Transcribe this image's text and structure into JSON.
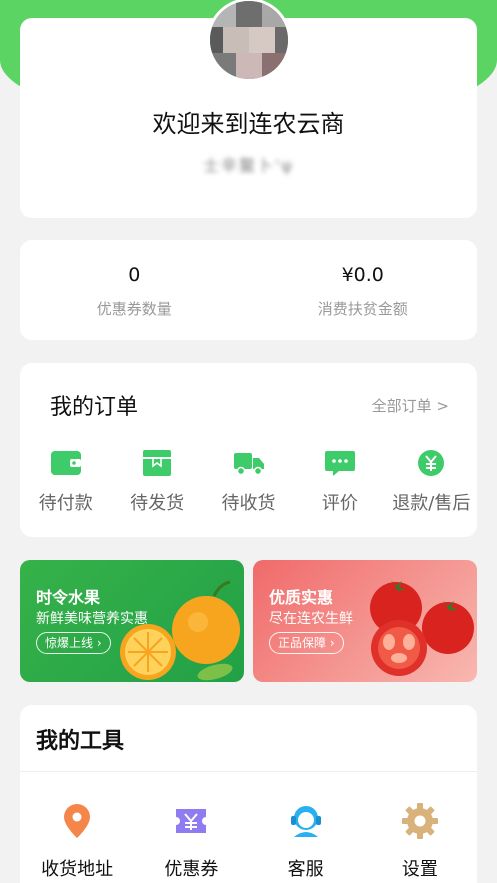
{
  "profile": {
    "welcome": "欢迎来到连农云商",
    "username": "士辛鳌卜'ψ"
  },
  "stats": [
    {
      "value": "0",
      "label": "优惠券数量"
    },
    {
      "value": "¥0.0",
      "label": "消费扶贫金额"
    }
  ],
  "orders": {
    "title": "我的订单",
    "all_link": "全部订单 >",
    "items": [
      {
        "label": "待付款",
        "icon": "wallet-icon"
      },
      {
        "label": "待发货",
        "icon": "package-icon"
      },
      {
        "label": "待收货",
        "icon": "truck-icon"
      },
      {
        "label": "评价",
        "icon": "chat-icon"
      },
      {
        "label": "退款/售后",
        "icon": "yuan-coin-icon"
      }
    ]
  },
  "promos": [
    {
      "title": "时令水果",
      "subtitle": "新鲜美味营养实惠",
      "button": "惊爆上线 ›"
    },
    {
      "title": "优质实惠",
      "subtitle": "尽在连农生鲜",
      "button": "正品保障 ›"
    }
  ],
  "tools": {
    "title": "我的工具",
    "items": [
      {
        "label": "收货地址",
        "icon": "location-pin-icon"
      },
      {
        "label": "优惠券",
        "icon": "coupon-icon"
      },
      {
        "label": "客服",
        "icon": "customer-service-icon"
      },
      {
        "label": "设置",
        "icon": "gear-icon"
      }
    ]
  },
  "colors": {
    "brand_green": "#5cd464",
    "icon_green": "#3ecb6a",
    "pin_orange": "#f5864a",
    "coupon_purple": "#8f7cf0",
    "service_blue": "#28b0f0",
    "gear_tan": "#d8b27a"
  }
}
